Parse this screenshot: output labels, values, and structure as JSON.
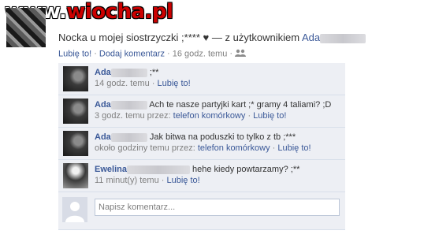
{
  "watermark": {
    "www": "www.",
    "brand": "wiocha.pl"
  },
  "post": {
    "text": "Nocka u mojej siostrzyczki ;****",
    "heart": "♥",
    "with_text": "— z użytkownikiem",
    "with_user": "Ada",
    "like_label": "Lubię to!",
    "comment_label": "Dodaj komentarz",
    "time": "16 godz. temu",
    "separator": "·",
    "people_icon": "people-icon"
  },
  "comments": [
    {
      "name": "Ada",
      "text": ";**",
      "time": "14 godz. temu",
      "via": "",
      "like_label": "Lubię to!"
    },
    {
      "name": "Ada",
      "text": "Ach te nasze partyjki kart ;* gramy 4 taliami? ;D",
      "time": "3 godz. temu przez:",
      "via": "telefon komórkowy",
      "like_label": "Lubię to!"
    },
    {
      "name": "Ada",
      "text": "Jak bitwa na poduszki to tylko z tb ;***",
      "time": "około godziny temu przez:",
      "via": "telefon komórkowy",
      "like_label": "Lubię to!"
    },
    {
      "name": "Ewelina",
      "text": "hehe kiedy powtarzamy? ;**",
      "time": "11 minut(y) temu",
      "via": "",
      "like_label": "Lubię to!"
    }
  ],
  "write_comment": {
    "placeholder": "Napisz komentarz..."
  },
  "colors": {
    "link": "#3b5998",
    "comment_bg": "#edeff4",
    "brand_red": "#cc0000"
  }
}
